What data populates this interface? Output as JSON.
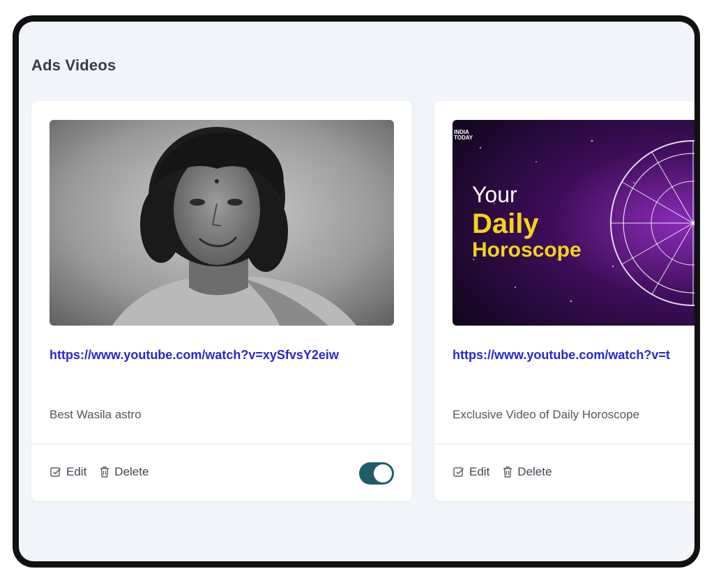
{
  "page": {
    "title": "Ads Videos"
  },
  "videos": [
    {
      "url": "https://www.youtube.com/watch?v=xySfvsY2eiw",
      "description": "Best Wasila astro",
      "thumbnail": "portrait of smiling young man with curly hair, black and white",
      "edit_label": "Edit",
      "delete_label": "Delete",
      "active": true
    },
    {
      "url": "https://www.youtube.com/watch?v=t",
      "description": "Exclusive Video of Daily Horoscope",
      "thumbnail": "daily horoscope zodiac wheel on purple starfield",
      "thumbnail_text": {
        "brand_line1": "INDIA",
        "brand_line2": "TODAY",
        "line1": "Your",
        "line2": "Daily",
        "line3": "Horoscope"
      },
      "edit_label": "Edit",
      "delete_label": "Delete"
    }
  ],
  "colors": {
    "background": "#f1f4f8",
    "link": "#2626d6",
    "toggle_on": "#1f5c6b",
    "horoscope_yellow": "#f4d21c"
  },
  "icons": {
    "edit": "edit-square-icon",
    "delete": "trash-icon"
  }
}
